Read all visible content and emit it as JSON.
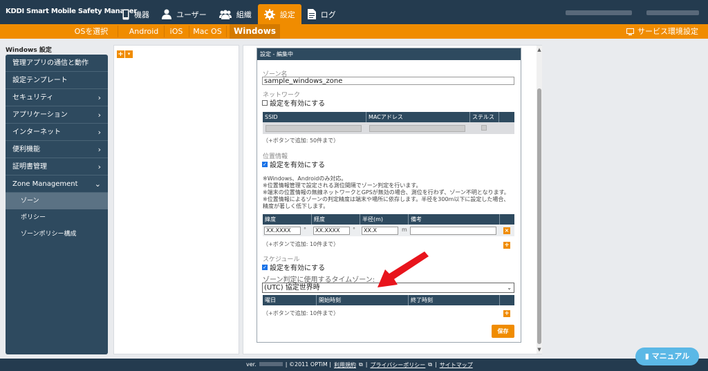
{
  "header": {
    "brand": "KDDI Smart Mobile Safety Manager",
    "nav": [
      {
        "label": "機器",
        "icon": "phone-icon"
      },
      {
        "label": "ユーザー",
        "icon": "user-icon"
      },
      {
        "label": "組織",
        "icon": "group-icon"
      },
      {
        "label": "設定",
        "icon": "gear-icon"
      },
      {
        "label": "ログ",
        "icon": "document-icon"
      }
    ]
  },
  "subnav": {
    "os_select": "OSを選択",
    "tabs": [
      "Android",
      "iOS",
      "Mac OS",
      "Windows"
    ],
    "service": "サービス環境設定"
  },
  "sidebar": {
    "title": "Windows 設定",
    "items": [
      {
        "label": "管理アプリの通信と動作",
        "chev": ""
      },
      {
        "label": "設定テンプレート",
        "chev": ""
      },
      {
        "label": "セキュリティ",
        "chev": "›"
      },
      {
        "label": "アプリケーション",
        "chev": "›"
      },
      {
        "label": "インターネット",
        "chev": "›"
      },
      {
        "label": "便利機能",
        "chev": "›"
      },
      {
        "label": "証明書管理",
        "chev": "›"
      },
      {
        "label": "Zone Management",
        "chev": "⌄"
      }
    ],
    "subitems": [
      "ゾーン",
      "ポリシー",
      "ゾーンポリシー構成"
    ]
  },
  "tree": {
    "add": "+",
    "dropdown": "▾"
  },
  "panel": {
    "title": "設定 - 編集中",
    "zone_name_label": "ゾーン名",
    "zone_name_value": "sample_windows_zone",
    "network_label": "ネットワーク",
    "enable_label": "設定を有効にする",
    "network_headers": [
      "SSID",
      "MACアドレス",
      "ステルス"
    ],
    "network_note": "（+ボタンで追加: 50件まで）",
    "location_label": "位置情報",
    "location_notes": [
      "※Windows、Androidのみ対応。",
      "※位置情報管理で設定される測位間隔でゾーン判定を行います。",
      "※端末の位置情報の無線ネットワークとGPSが無効の場合、測位を行わず、ゾーン不明となります。",
      "※位置情報によるゾーンの判定精度は端末や場所に依存します。半径を300m以下に設定した場合、",
      "精度が著しく低下します。"
    ],
    "location_headers": [
      "緯度",
      "経度",
      "半径(m)",
      "備考"
    ],
    "lat_value": "XX.XXXX",
    "lng_value": "XX.XXXX",
    "radius_value": "XX.X",
    "deg": "°",
    "meter": "m",
    "location_note": "（+ボタンで追加: 10件まで）",
    "schedule_label": "スケジュール",
    "timezone_label": "ゾーン判定に使用するタイムゾーン:",
    "timezone_value": "(UTC) 協定世界時",
    "schedule_headers": [
      "曜日",
      "開始時刻",
      "終了時刻"
    ],
    "schedule_note": "（+ボタンで追加: 10件まで）",
    "save": "保存",
    "delete": "×",
    "add": "+"
  },
  "footer": {
    "version": "ver.",
    "copyright": "| ©2011 OPTiM |",
    "terms": "利用規約",
    "privacy": "プライバシーポリシー",
    "sitemap": "サイトマップ",
    "sep": "|"
  },
  "manual": "マニュアル",
  "colors": {
    "header": "#243b4f",
    "accent": "#f08c00",
    "sidebar": "#2e4a5f",
    "manual": "#5bb8e6",
    "arrow": "#e8141c"
  }
}
